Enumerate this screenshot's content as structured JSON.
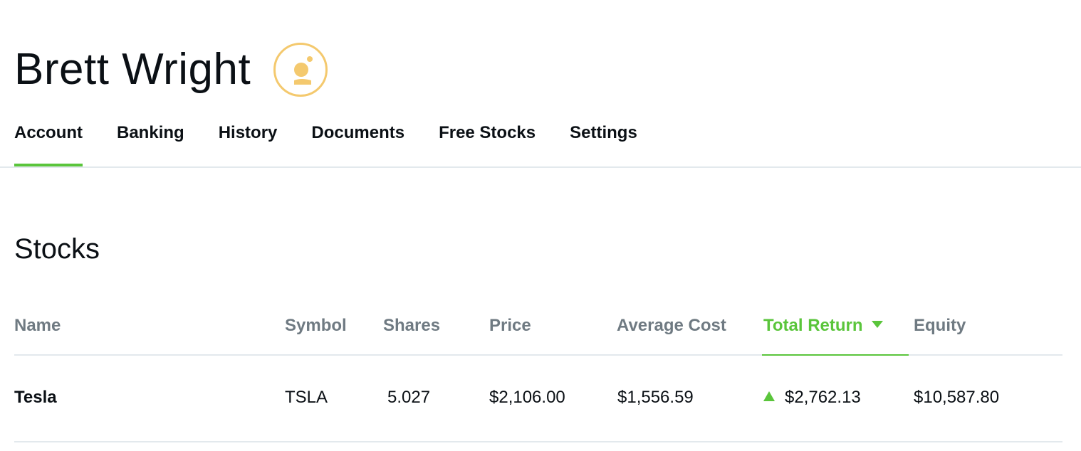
{
  "profile": {
    "name": "Brett Wright",
    "avatar_icon": "user-avatar-icon",
    "avatar_color": "#f4c96e"
  },
  "tabs": [
    {
      "label": "Account",
      "active": true
    },
    {
      "label": "Banking",
      "active": false
    },
    {
      "label": "History",
      "active": false
    },
    {
      "label": "Documents",
      "active": false
    },
    {
      "label": "Free Stocks",
      "active": false
    },
    {
      "label": "Settings",
      "active": false
    }
  ],
  "section": {
    "title": "Stocks"
  },
  "table": {
    "columns": [
      "Name",
      "Symbol",
      "Shares",
      "Price",
      "Average Cost",
      "Total Return",
      "Equity"
    ],
    "sorted_column": "Total Return",
    "sort_icon": "caret-down-icon",
    "rows": [
      {
        "name": "Tesla",
        "symbol": "TSLA",
        "shares": "5.027",
        "price": "$2,106.00",
        "average_cost": "$1,556.59",
        "total_return": "$2,762.13",
        "total_return_direction": "up",
        "equity": "$10,587.80"
      }
    ]
  },
  "colors": {
    "accent": "#5ac53b",
    "text": "#0b1015",
    "muted": "#6f7a82",
    "divider": "#e3e9ed"
  }
}
